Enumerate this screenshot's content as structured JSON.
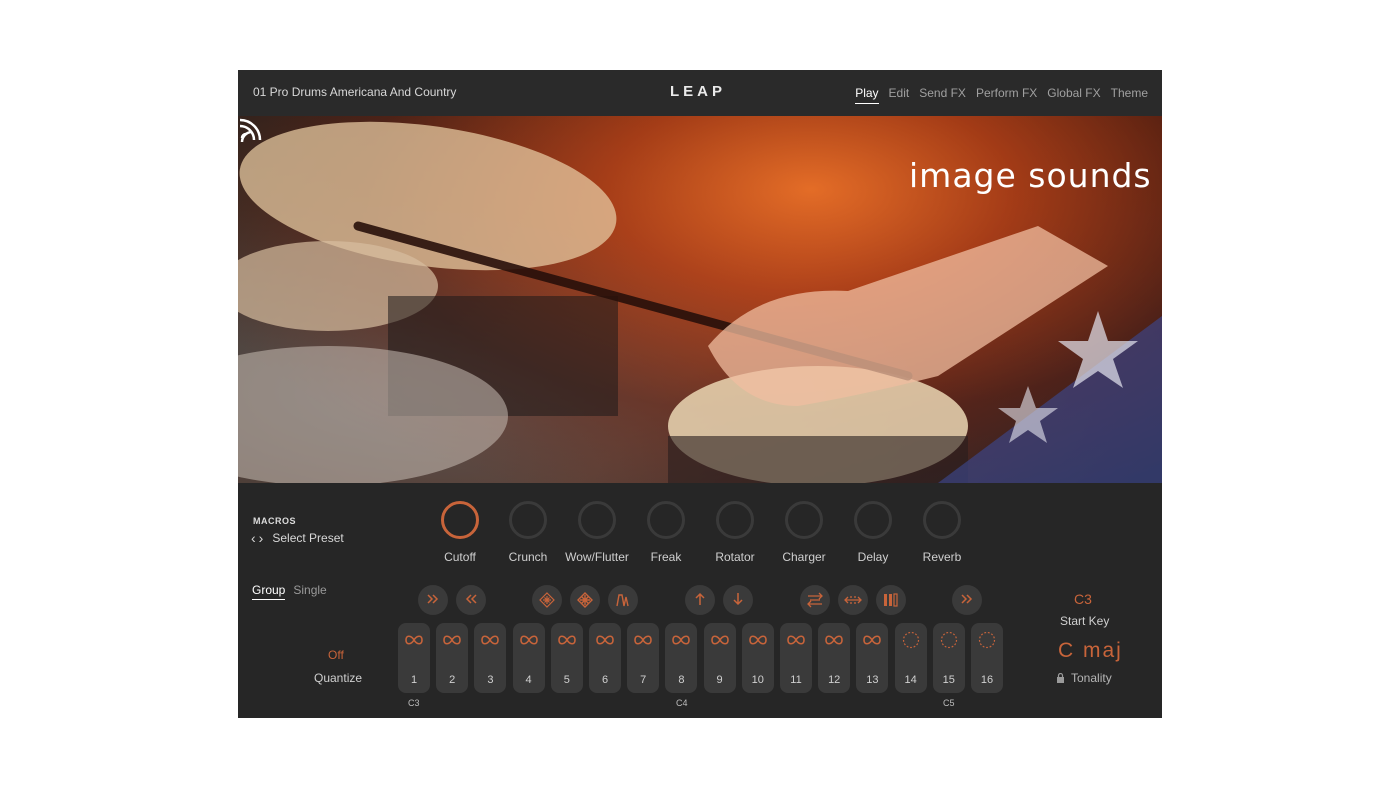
{
  "header": {
    "preset_name": "01 Pro Drums Americana And Country",
    "logo": "LEAP",
    "tabs": [
      {
        "label": "Play",
        "active": true
      },
      {
        "label": "Edit",
        "active": false
      },
      {
        "label": "Send FX",
        "active": false
      },
      {
        "label": "Perform FX",
        "active": false
      },
      {
        "label": "Global FX",
        "active": false
      },
      {
        "label": "Theme",
        "active": false
      }
    ]
  },
  "hero": {
    "brand": "image sounds"
  },
  "macros": {
    "title": "MACROS",
    "select_preset": "Select Preset",
    "knobs": [
      {
        "label": "Cutoff",
        "active": true
      },
      {
        "label": "Crunch",
        "active": false
      },
      {
        "label": "Wow/Flutter",
        "active": false
      },
      {
        "label": "Freak",
        "active": false
      },
      {
        "label": "Rotator",
        "active": false
      },
      {
        "label": "Charger",
        "active": false
      },
      {
        "label": "Delay",
        "active": false
      },
      {
        "label": "Reverb",
        "active": false
      }
    ]
  },
  "mode": {
    "group": "Group",
    "single": "Single",
    "active": "Group"
  },
  "quantize": {
    "value": "Off",
    "label": "Quantize"
  },
  "pads": {
    "numbers": [
      "1",
      "2",
      "3",
      "4",
      "5",
      "6",
      "7",
      "8",
      "9",
      "10",
      "11",
      "12",
      "13",
      "14",
      "15",
      "16"
    ],
    "note_labels": {
      "c3": "C3",
      "c4": "C4",
      "c5": "C5"
    }
  },
  "start_key": {
    "value": "C3",
    "label": "Start Key"
  },
  "tonality": {
    "value": "C  maj",
    "label": "Tonality"
  },
  "colors": {
    "accent": "#c8643a",
    "panel": "#262626",
    "pad": "#3a3a3a"
  }
}
